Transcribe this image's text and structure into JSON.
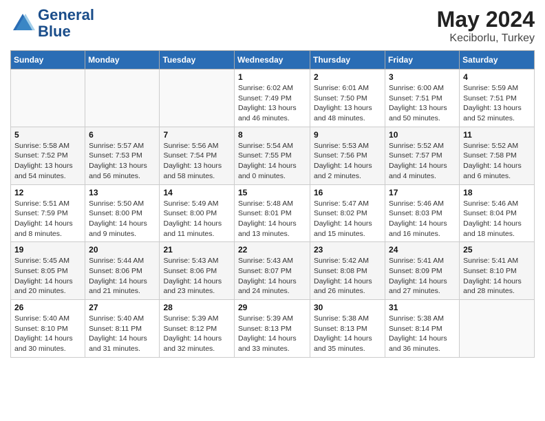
{
  "header": {
    "logo_line1": "General",
    "logo_line2": "Blue",
    "month_year": "May 2024",
    "location": "Keciborlu, Turkey"
  },
  "weekdays": [
    "Sunday",
    "Monday",
    "Tuesday",
    "Wednesday",
    "Thursday",
    "Friday",
    "Saturday"
  ],
  "weeks": [
    [
      {
        "day": "",
        "info": ""
      },
      {
        "day": "",
        "info": ""
      },
      {
        "day": "",
        "info": ""
      },
      {
        "day": "1",
        "info": "Sunrise: 6:02 AM\nSunset: 7:49 PM\nDaylight: 13 hours\nand 46 minutes."
      },
      {
        "day": "2",
        "info": "Sunrise: 6:01 AM\nSunset: 7:50 PM\nDaylight: 13 hours\nand 48 minutes."
      },
      {
        "day": "3",
        "info": "Sunrise: 6:00 AM\nSunset: 7:51 PM\nDaylight: 13 hours\nand 50 minutes."
      },
      {
        "day": "4",
        "info": "Sunrise: 5:59 AM\nSunset: 7:51 PM\nDaylight: 13 hours\nand 52 minutes."
      }
    ],
    [
      {
        "day": "5",
        "info": "Sunrise: 5:58 AM\nSunset: 7:52 PM\nDaylight: 13 hours\nand 54 minutes."
      },
      {
        "day": "6",
        "info": "Sunrise: 5:57 AM\nSunset: 7:53 PM\nDaylight: 13 hours\nand 56 minutes."
      },
      {
        "day": "7",
        "info": "Sunrise: 5:56 AM\nSunset: 7:54 PM\nDaylight: 13 hours\nand 58 minutes."
      },
      {
        "day": "8",
        "info": "Sunrise: 5:54 AM\nSunset: 7:55 PM\nDaylight: 14 hours\nand 0 minutes."
      },
      {
        "day": "9",
        "info": "Sunrise: 5:53 AM\nSunset: 7:56 PM\nDaylight: 14 hours\nand 2 minutes."
      },
      {
        "day": "10",
        "info": "Sunrise: 5:52 AM\nSunset: 7:57 PM\nDaylight: 14 hours\nand 4 minutes."
      },
      {
        "day": "11",
        "info": "Sunrise: 5:52 AM\nSunset: 7:58 PM\nDaylight: 14 hours\nand 6 minutes."
      }
    ],
    [
      {
        "day": "12",
        "info": "Sunrise: 5:51 AM\nSunset: 7:59 PM\nDaylight: 14 hours\nand 8 minutes."
      },
      {
        "day": "13",
        "info": "Sunrise: 5:50 AM\nSunset: 8:00 PM\nDaylight: 14 hours\nand 9 minutes."
      },
      {
        "day": "14",
        "info": "Sunrise: 5:49 AM\nSunset: 8:00 PM\nDaylight: 14 hours\nand 11 minutes."
      },
      {
        "day": "15",
        "info": "Sunrise: 5:48 AM\nSunset: 8:01 PM\nDaylight: 14 hours\nand 13 minutes."
      },
      {
        "day": "16",
        "info": "Sunrise: 5:47 AM\nSunset: 8:02 PM\nDaylight: 14 hours\nand 15 minutes."
      },
      {
        "day": "17",
        "info": "Sunrise: 5:46 AM\nSunset: 8:03 PM\nDaylight: 14 hours\nand 16 minutes."
      },
      {
        "day": "18",
        "info": "Sunrise: 5:46 AM\nSunset: 8:04 PM\nDaylight: 14 hours\nand 18 minutes."
      }
    ],
    [
      {
        "day": "19",
        "info": "Sunrise: 5:45 AM\nSunset: 8:05 PM\nDaylight: 14 hours\nand 20 minutes."
      },
      {
        "day": "20",
        "info": "Sunrise: 5:44 AM\nSunset: 8:06 PM\nDaylight: 14 hours\nand 21 minutes."
      },
      {
        "day": "21",
        "info": "Sunrise: 5:43 AM\nSunset: 8:06 PM\nDaylight: 14 hours\nand 23 minutes."
      },
      {
        "day": "22",
        "info": "Sunrise: 5:43 AM\nSunset: 8:07 PM\nDaylight: 14 hours\nand 24 minutes."
      },
      {
        "day": "23",
        "info": "Sunrise: 5:42 AM\nSunset: 8:08 PM\nDaylight: 14 hours\nand 26 minutes."
      },
      {
        "day": "24",
        "info": "Sunrise: 5:41 AM\nSunset: 8:09 PM\nDaylight: 14 hours\nand 27 minutes."
      },
      {
        "day": "25",
        "info": "Sunrise: 5:41 AM\nSunset: 8:10 PM\nDaylight: 14 hours\nand 28 minutes."
      }
    ],
    [
      {
        "day": "26",
        "info": "Sunrise: 5:40 AM\nSunset: 8:10 PM\nDaylight: 14 hours\nand 30 minutes."
      },
      {
        "day": "27",
        "info": "Sunrise: 5:40 AM\nSunset: 8:11 PM\nDaylight: 14 hours\nand 31 minutes."
      },
      {
        "day": "28",
        "info": "Sunrise: 5:39 AM\nSunset: 8:12 PM\nDaylight: 14 hours\nand 32 minutes."
      },
      {
        "day": "29",
        "info": "Sunrise: 5:39 AM\nSunset: 8:13 PM\nDaylight: 14 hours\nand 33 minutes."
      },
      {
        "day": "30",
        "info": "Sunrise: 5:38 AM\nSunset: 8:13 PM\nDaylight: 14 hours\nand 35 minutes."
      },
      {
        "day": "31",
        "info": "Sunrise: 5:38 AM\nSunset: 8:14 PM\nDaylight: 14 hours\nand 36 minutes."
      },
      {
        "day": "",
        "info": ""
      }
    ]
  ]
}
